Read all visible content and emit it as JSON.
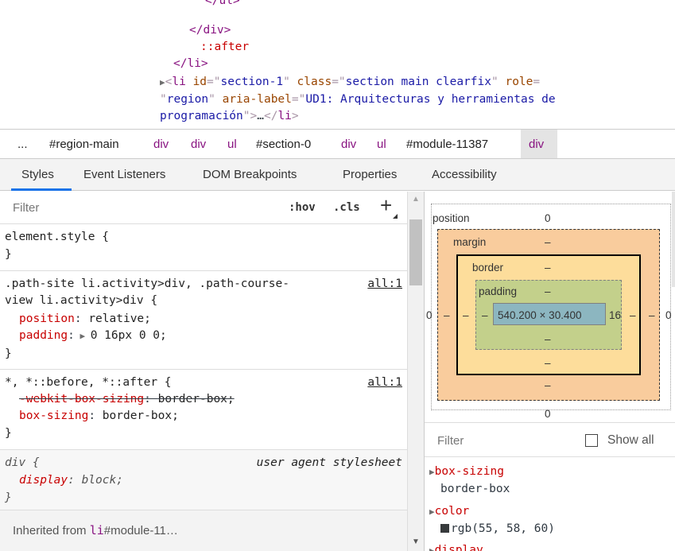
{
  "dom_tree": {
    "line_ul_close": "</ul>",
    "line_div_close": "</div>",
    "line_after": "::after",
    "line_li_close": "</li>",
    "li_tag": "li",
    "li_id_attr": "id",
    "li_id_val": "section-1",
    "li_class_attr": "class",
    "li_class_val": "section main clearfix",
    "li_role_attr": "role",
    "li_role_val": "region",
    "li_aria_attr": "aria-label",
    "li_aria_val_1": "UD1: Arquitecturas y herramientas de",
    "li_aria_val_2": "programación",
    "li_ellipsis": "…"
  },
  "breadcrumb": {
    "ellipsis": "...",
    "items": [
      "#region-main",
      "div",
      "div",
      "ul",
      "#section-0",
      "div",
      "ul",
      "#module-11387",
      "div"
    ]
  },
  "tabs": [
    "Styles",
    "Event Listeners",
    "DOM Breakpoints",
    "Properties",
    "Accessibility"
  ],
  "styles": {
    "filter_placeholder": "Filter",
    "hov": ":hov",
    "cls": ".cls",
    "add": "+",
    "element_style": "element.style {",
    "rule1": {
      "selector_1": ".path-site li.activity>div, .path-course-",
      "selector_2": "view li.activity>div {",
      "source": "all:1",
      "decls": [
        {
          "prop": "position",
          "val": "relative;"
        },
        {
          "prop": "padding",
          "val": "0 16px 0 0;"
        }
      ]
    },
    "rule2": {
      "selector": "*, *::before, *::after {",
      "source": "all:1",
      "decls": [
        {
          "prop": "-webkit-box-sizing",
          "val": "border-box;"
        },
        {
          "prop": "box-sizing",
          "val": "border-box;"
        }
      ]
    },
    "rule3": {
      "selector": "div {",
      "source": "user agent stylesheet",
      "decls": [
        {
          "prop": "display",
          "val": "block;"
        }
      ]
    },
    "close_brace": "}",
    "inherited_prefix": "Inherited from ",
    "inherited_tag": "li",
    "inherited_rest": "#module-11…"
  },
  "box_model": {
    "position_label": "position",
    "position_top": "0",
    "position_bottom": "0",
    "position_left": "0",
    "position_right": "0",
    "margin_label": "margin",
    "margin_val": "–",
    "border_label": "border",
    "border_val": "–",
    "padding_label": "padding",
    "padding_val": "–",
    "content": "540.200 × 30.400",
    "padding_right": "16"
  },
  "computed": {
    "filter_placeholder": "Filter",
    "show_all": "Show all",
    "props": [
      {
        "name": "box-sizing",
        "value": "border-box"
      },
      {
        "name": "color",
        "value": "rgb(55, 58, 60)"
      },
      {
        "name": "display",
        "value": ""
      }
    ],
    "color_swatch": "#373a3c"
  },
  "colors": {
    "accent": "#1a73e8",
    "margin": "#f9cc9d",
    "border": "#fddd9b",
    "padding": "#c3d08b",
    "content": "#8cb6c0"
  }
}
